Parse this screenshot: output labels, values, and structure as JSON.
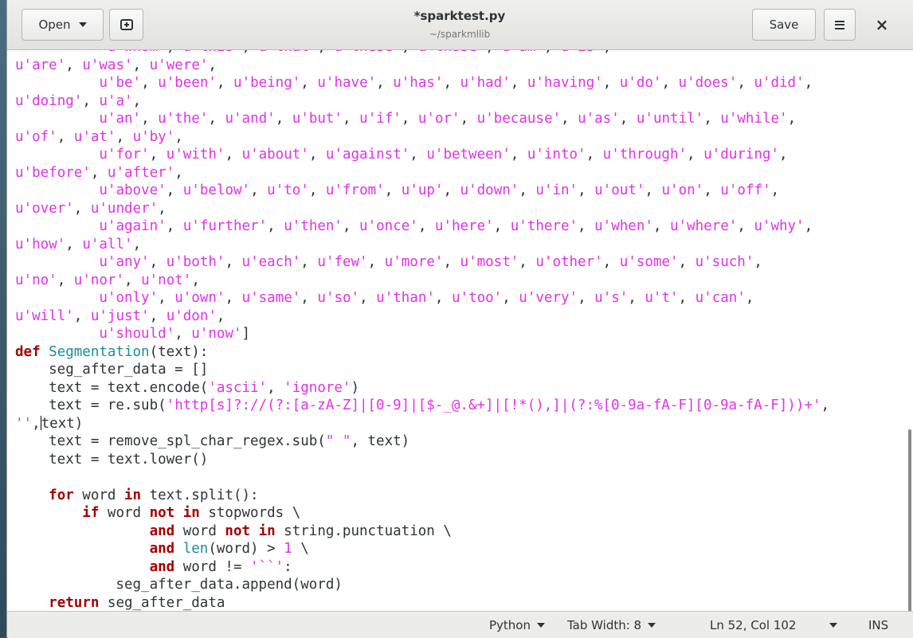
{
  "header": {
    "open_label": "Open",
    "title": "*sparktest.py",
    "subtitle": "~/sparkmllib",
    "save_label": "Save"
  },
  "code_lines": [
    "u'are', u'was', u'were',",
    "          u'be', u'been', u'being', u'have', u'has', u'had', u'having', u'do', u'does', u'did',",
    "u'doing', u'a',",
    "          u'an', u'the', u'and', u'but', u'if', u'or', u'because', u'as', u'until', u'while',",
    "u'of', u'at', u'by',",
    "          u'for', u'with', u'about', u'against', u'between', u'into', u'through', u'during',",
    "u'before', u'after',",
    "          u'above', u'below', u'to', u'from', u'up', u'down', u'in', u'out', u'on', u'off',",
    "u'over', u'under',",
    "          u'again', u'further', u'then', u'once', u'here', u'there', u'when', u'where', u'why',",
    "u'how', u'all',",
    "          u'any', u'both', u'each', u'few', u'more', u'most', u'other', u'some', u'such',",
    "u'no', u'nor', u'not',",
    "          u'only', u'own', u'same', u'so', u'than', u'too', u'very', u's', u't', u'can',",
    "u'will', u'just', u'don',",
    "          u'should', u'now']",
    "def Segmentation(text):",
    "    seg_after_data = []",
    "    text = text.encode('ascii', 'ignore')",
    "    text = re.sub('http[s]?://(?:[a-zA-Z]|[0-9]|[$-_@.&+]|[!*(),]|(?:%[0-9a-fA-F][0-9a-fA-F]))+',",
    "'',text)",
    "    text = remove_spl_char_regex.sub(\" \", text)",
    "    text = text.lower()",
    "",
    "    for word in text.split():",
    "        if word not in stopwords \\",
    "                and word not in string.punctuation \\",
    "                and len(word) > 1 \\",
    "                and word != '``':",
    "            seg_after_data.append(word)",
    "    return seg_after_data"
  ],
  "status": {
    "language": "Python",
    "tab_width": "Tab Width: 8",
    "position": "Ln 52, Col 102",
    "mode": "INS"
  }
}
